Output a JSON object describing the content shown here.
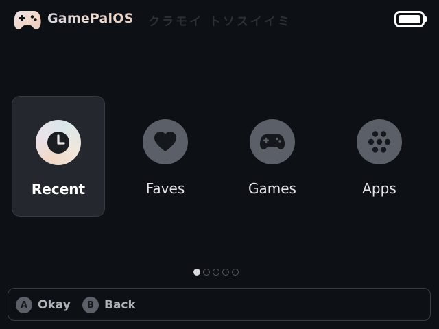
{
  "header": {
    "title": "GamePalOS",
    "subtitle_kana": "クラモイ トソスイイミ",
    "logo_icon": "gamepad-icon",
    "battery_icon": "battery-full-icon"
  },
  "menu": {
    "items": [
      {
        "label": "Recent",
        "icon": "clock-icon",
        "selected": true
      },
      {
        "label": "Faves",
        "icon": "heart-icon",
        "selected": false
      },
      {
        "label": "Games",
        "icon": "gamepad-icon",
        "selected": false
      },
      {
        "label": "Apps",
        "icon": "apps-grid-icon",
        "selected": false
      }
    ]
  },
  "pager": {
    "pages": 5,
    "current": 1
  },
  "footer": {
    "hints": [
      {
        "button": "A",
        "label": "Okay"
      },
      {
        "button": "B",
        "label": "Back"
      }
    ]
  },
  "colors": {
    "background": "#0d1015",
    "tile_selected": "#24272d",
    "icon_circle": "#5b5f67"
  }
}
